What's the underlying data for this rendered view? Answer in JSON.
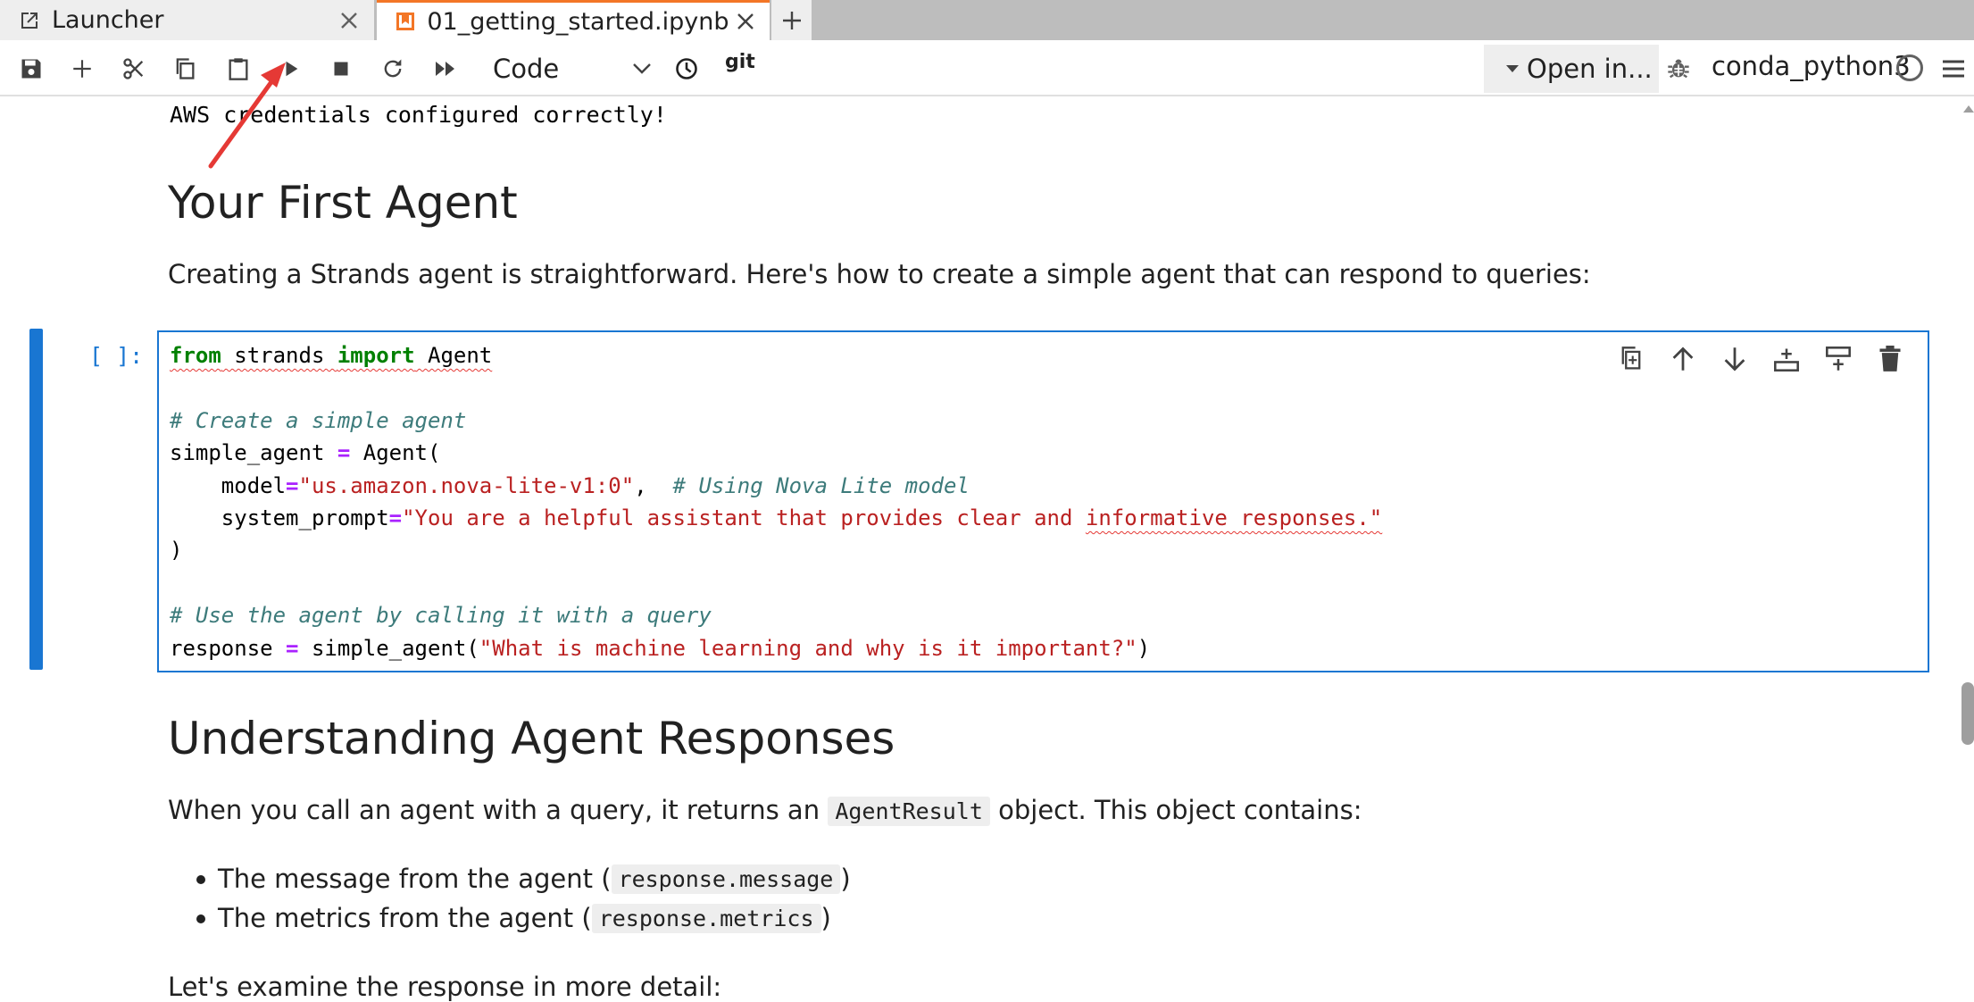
{
  "tabs": [
    {
      "label": "Launcher",
      "icon": "external-link-icon",
      "active": false
    },
    {
      "label": "01_getting_started.ipynb",
      "icon": "notebook-icon",
      "active": true
    }
  ],
  "toolbar": {
    "cell_type": "Code",
    "git_label": "git",
    "open_in_label": "Open in...",
    "kernel_name": "conda_python3"
  },
  "notebook": {
    "previous_output": "AWS credentials configured correctly!",
    "heading_first_agent": "Your First Agent",
    "para_first_agent": "Creating a Strands agent is straightforward. Here's how to create a simple agent that can respond to queries:",
    "cell_prompt": "[ ]:",
    "code": {
      "line1_kw1": "from",
      "line1_mod": " strands ",
      "line1_kw2": "import",
      "line1_name": " Agent",
      "line3_comment": "# Create a simple agent",
      "line4_var": "simple_agent ",
      "line4_op": "=",
      "line4_call": " Agent(",
      "line5_indent": "    model",
      "line5_op": "=",
      "line5_str": "\"us.amazon.nova-lite-v1:0\"",
      "line5_sep": ",  ",
      "line5_comment": "# Using Nova Lite model",
      "line6_indent": "    system_prompt",
      "line6_op": "=",
      "line6_str_a": "\"You are a helpful assistant that provides clear and ",
      "line6_str_b": "informative responses.\"",
      "line7_close": ")",
      "line9_comment": "# Use the agent by calling it with a query",
      "line10_var": "response ",
      "line10_op": "=",
      "line10_call": " simple_agent(",
      "line10_str": "\"What is machine learning and why is it important?\"",
      "line10_close": ")"
    },
    "heading_understanding": "Understanding Agent Responses",
    "para_understanding_pre": "When you call an agent with a query, it returns an ",
    "para_understanding_code": "AgentResult",
    "para_understanding_post": " object. This object contains:",
    "bullets": [
      {
        "pre": "The message from the agent (",
        "code": "response.message",
        "post": ")"
      },
      {
        "pre": "The metrics from the agent (",
        "code": "response.metrics",
        "post": ")"
      }
    ],
    "para_examine": "Let's examine the response in more detail:"
  },
  "colors": {
    "accent": "#1976d2",
    "tab_accent": "#f37626",
    "annotation_arrow": "#e53935",
    "keyword": "#008000",
    "string": "#ba2121",
    "comment": "#3d7b7b",
    "operator": "#aa22ff"
  }
}
